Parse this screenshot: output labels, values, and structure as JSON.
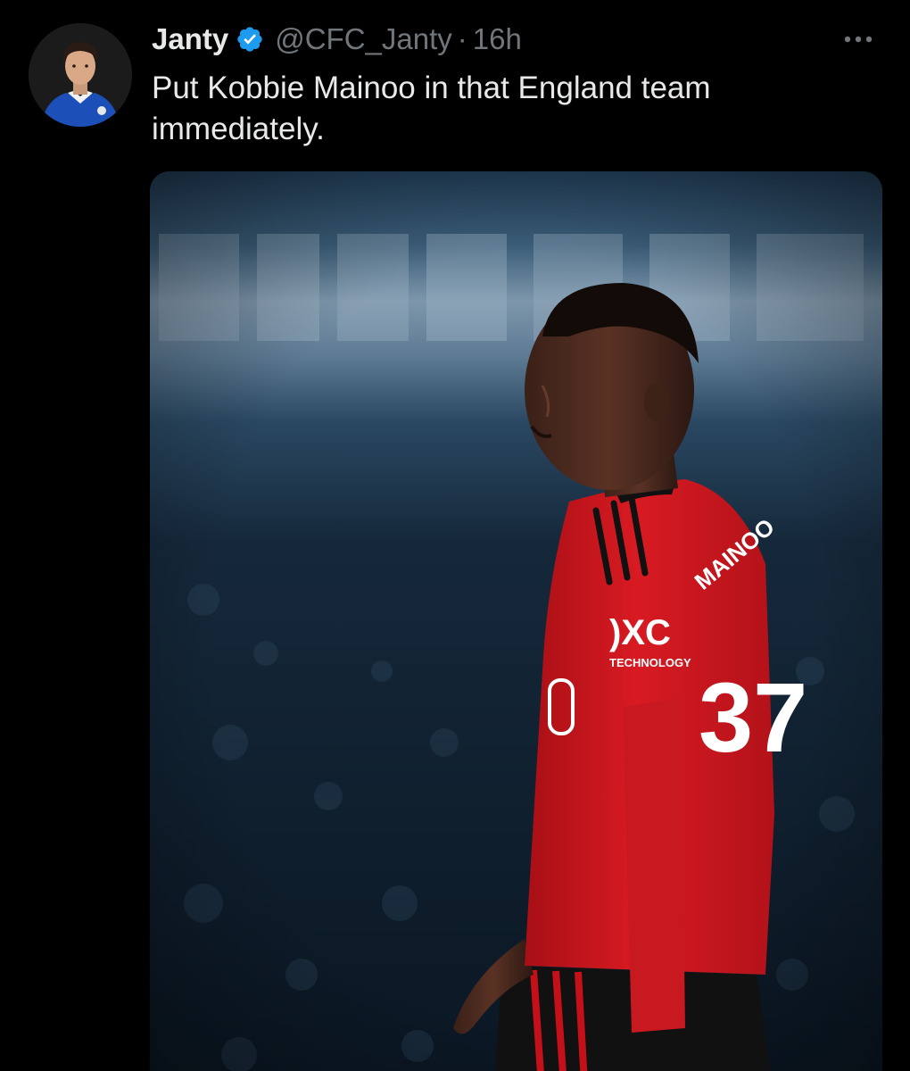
{
  "post": {
    "author": {
      "display_name": "Janty",
      "handle": "@CFC_Janty",
      "verified": true,
      "verified_icon": "verified-badge-icon",
      "avatar_icon": "avatar"
    },
    "separator": "·",
    "timestamp": "16h",
    "more_icon": "more-options-icon",
    "text": "Put Kobbie Mainoo in that England team immediately.",
    "media": {
      "type": "photo",
      "shirt_sponsor": "TECHNOLOGY",
      "shirt_number": "37",
      "shirt_name": "MAINOO"
    }
  },
  "colors": {
    "background": "#000000",
    "text_primary": "#e7e9ea",
    "text_secondary": "#71767b",
    "verified_blue": "#1d9bf0",
    "kit_red": "#d4141c"
  }
}
